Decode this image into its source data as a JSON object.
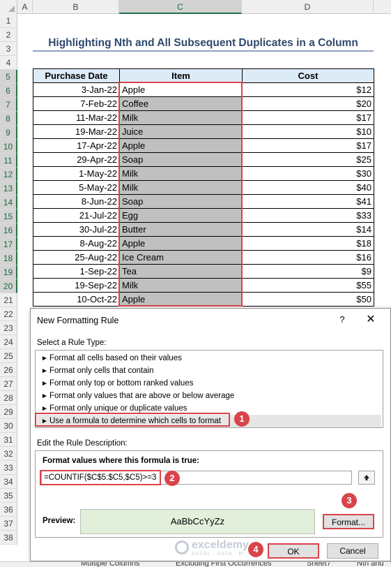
{
  "sheet": {
    "columns": [
      "A",
      "B",
      "C",
      "D"
    ],
    "rows": [
      "1",
      "2",
      "3",
      "4",
      "5",
      "6",
      "7",
      "8",
      "9",
      "10",
      "11",
      "12",
      "13",
      "14",
      "15",
      "16",
      "17",
      "18",
      "19",
      "20",
      "21",
      "22",
      "23",
      "24",
      "25",
      "26",
      "27",
      "28",
      "29",
      "30",
      "31",
      "32",
      "33",
      "34",
      "35",
      "36",
      "37",
      "38"
    ],
    "title": "Highlighting Nth and All Subsequent Duplicates in a Column",
    "headers": {
      "date": "Purchase Date",
      "item": "Item",
      "cost": "Cost"
    },
    "records": [
      {
        "date": "3-Jan-22",
        "item": "Apple",
        "cost": "$12"
      },
      {
        "date": "7-Feb-22",
        "item": "Coffee",
        "cost": "$20"
      },
      {
        "date": "11-Mar-22",
        "item": "Milk",
        "cost": "$17"
      },
      {
        "date": "19-Mar-22",
        "item": "Juice",
        "cost": "$10"
      },
      {
        "date": "17-Apr-22",
        "item": "Apple",
        "cost": "$17"
      },
      {
        "date": "29-Apr-22",
        "item": "Soap",
        "cost": "$25"
      },
      {
        "date": "1-May-22",
        "item": "Milk",
        "cost": "$30"
      },
      {
        "date": "5-May-22",
        "item": "Milk",
        "cost": "$40"
      },
      {
        "date": "8-Jun-22",
        "item": "Soap",
        "cost": "$41"
      },
      {
        "date": "21-Jul-22",
        "item": "Egg",
        "cost": "$33"
      },
      {
        "date": "30-Jul-22",
        "item": "Butter",
        "cost": "$14"
      },
      {
        "date": "8-Aug-22",
        "item": "Apple",
        "cost": "$18"
      },
      {
        "date": "25-Aug-22",
        "item": "Ice Cream",
        "cost": "$16"
      },
      {
        "date": "1-Sep-22",
        "item": "Tea",
        "cost": "$9"
      },
      {
        "date": "19-Sep-22",
        "item": "Milk",
        "cost": "$55"
      },
      {
        "date": "10-Oct-22",
        "item": "Apple",
        "cost": "$50"
      }
    ]
  },
  "dialog": {
    "title": "New Formatting Rule",
    "help": "?",
    "close": "✕",
    "select_rule_label": "Select a Rule Type:",
    "rule_types": [
      "Format all cells based on their values",
      "Format only cells that contain",
      "Format only top or bottom ranked values",
      "Format only values that are above or below average",
      "Format only unique or duplicate values",
      "Use a formula to determine which cells to format"
    ],
    "selected_rule_index": 5,
    "edit_label": "Edit the Rule Description:",
    "formula_label": "Format values where this formula is true:",
    "formula_value": "=COUNTIF($C$5:$C5,$C5)>=3",
    "preview_label": "Preview:",
    "preview_text": "AaBbCcYyZz",
    "preview_fill": "#e2efda",
    "format_button": "Format...",
    "ok_button": "OK",
    "cancel_button": "Cancel"
  },
  "badges": [
    "1",
    "2",
    "3",
    "4"
  ],
  "watermark": {
    "name": "exceldemy",
    "sub": "EXCEL · DATA · BI"
  },
  "tabs": [
    "Multiple Columns",
    "Excluding First Occurrences",
    "Sheet7",
    "Nth and"
  ],
  "colors": {
    "accent_red": "#d9434a",
    "header_fill": "#ddebf7",
    "highlight_gray": "#c0c0c0",
    "excel_green": "#217346"
  }
}
